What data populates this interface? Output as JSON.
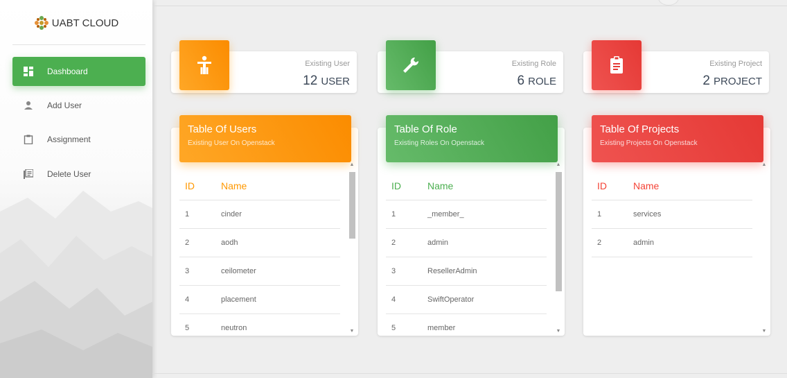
{
  "brand": {
    "name": "UABT CLOUD"
  },
  "sidebar": {
    "items": [
      {
        "label": "Dashboard",
        "icon": "dashboard-icon",
        "active": true
      },
      {
        "label": "Add User",
        "icon": "person-icon",
        "active": false
      },
      {
        "label": "Assignment",
        "icon": "clipboard-icon",
        "active": false
      },
      {
        "label": "Delete User",
        "icon": "library-books-icon",
        "active": false
      }
    ]
  },
  "stats": [
    {
      "caption": "Existing User",
      "value": "12",
      "unit": "USER",
      "color": "#ff9800",
      "icon": "accessibility-icon"
    },
    {
      "caption": "Existing Role",
      "value": "6",
      "unit": "ROLE",
      "color": "#4caf50",
      "icon": "wrench-icon"
    },
    {
      "caption": "Existing Project",
      "value": "2",
      "unit": "PROJECT",
      "color": "#f44336",
      "icon": "assignment-icon"
    }
  ],
  "tables": [
    {
      "title": "Table Of Users",
      "subtitle": "Existing User On Openstack",
      "color": "#ff9800",
      "columns": [
        "ID",
        "Name"
      ],
      "rows": [
        [
          "1",
          "cinder"
        ],
        [
          "2",
          "aodh"
        ],
        [
          "3",
          "ceilometer"
        ],
        [
          "4",
          "placement"
        ],
        [
          "5",
          "neutron"
        ]
      ]
    },
    {
      "title": "Table Of Role",
      "subtitle": "Existing Roles On Openstack",
      "color": "#4caf50",
      "columns": [
        "ID",
        "Name"
      ],
      "rows": [
        [
          "1",
          "_member_"
        ],
        [
          "2",
          "admin"
        ],
        [
          "3",
          "ResellerAdmin"
        ],
        [
          "4",
          "SwiftOperator"
        ],
        [
          "5",
          "member"
        ]
      ]
    },
    {
      "title": "Table Of Projects",
      "subtitle": "Existing Projects On Openstack",
      "color": "#f44336",
      "columns": [
        "ID",
        "Name"
      ],
      "rows": [
        [
          "1",
          "services"
        ],
        [
          "2",
          "admin"
        ]
      ]
    }
  ]
}
